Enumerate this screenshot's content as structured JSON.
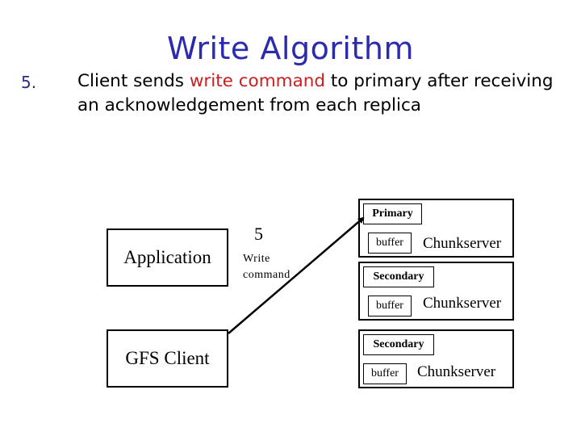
{
  "slide": {
    "title": "Write Algorithm",
    "step_number": "5.",
    "bullet": {
      "part1": "Client sends ",
      "highlight": "write command",
      "part2": " to primary after receiving an acknowledgement from each replica"
    },
    "colors": {
      "title": "#2b2bb0",
      "highlight": "#cc1f1f",
      "number": "#2b2b8c"
    }
  },
  "diagram": {
    "application_label": "Application",
    "client_label": "GFS Client",
    "arrow": {
      "step": "5",
      "label_line1": "Write",
      "label_line2": "command"
    },
    "chunkservers": [
      {
        "role": "Primary",
        "buffer": "buffer",
        "label": "Chunkserver"
      },
      {
        "role": "Secondary",
        "buffer": "buffer",
        "label": "Chunkserver"
      },
      {
        "role": "Secondary",
        "buffer": "buffer",
        "label": "Chunkserver"
      }
    ]
  }
}
